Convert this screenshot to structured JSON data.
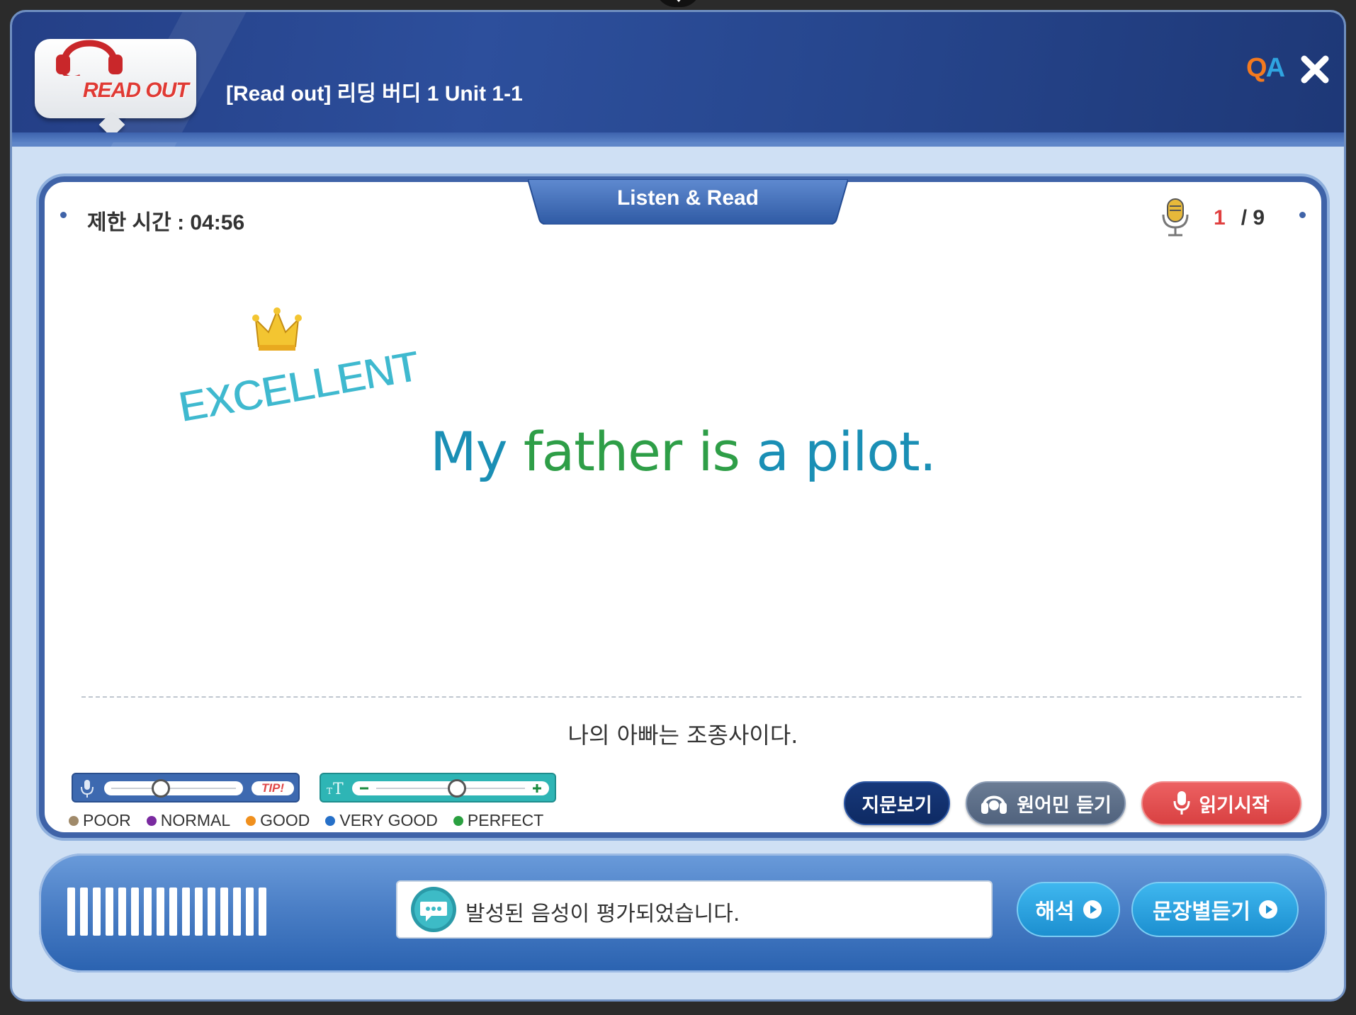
{
  "header": {
    "logo_text": "READ OUT",
    "title": "[Read out] 리딩 버디 1 Unit 1-1",
    "qa_q": "Q",
    "qa_a": "A"
  },
  "panel": {
    "timer": "제한 시간 : 04:56",
    "tab_title": "Listen & Read",
    "counter_current": "1",
    "counter_total": "/ 9",
    "result_badge": "EXCELLENT",
    "sentence_words": [
      {
        "text": "My",
        "color": "#1a8fb5"
      },
      {
        "text": "father",
        "color": "#2e9e47"
      },
      {
        "text": "is",
        "color": "#2e9e47"
      },
      {
        "text": "a",
        "color": "#1a8fb5"
      },
      {
        "text": "pilot.",
        "color": "#1a8fb5"
      }
    ],
    "translation": "나의 아빠는 조종사이다.",
    "tip_label": "TIP!",
    "mic_sensitivity_level": 0.38,
    "font_size_level": 0.55
  },
  "legend": [
    {
      "label": "POOR",
      "color": "#a08a6a"
    },
    {
      "label": "NORMAL",
      "color": "#7a2aa0"
    },
    {
      "label": "GOOD",
      "color": "#f0901e"
    },
    {
      "label": "VERY GOOD",
      "color": "#2670c8"
    },
    {
      "label": "PERFECT",
      "color": "#2aa040"
    }
  ],
  "buttons": {
    "passage": "지문보기",
    "native": "원어민 듣기",
    "read": "읽기시작",
    "interpretation": "해석",
    "sentence_listen": "문장별듣기"
  },
  "status": {
    "message": "발성된 음성이 평가되었습니다."
  },
  "colors": {
    "header_blue": "#27478f",
    "read_red": "#e04848",
    "accent_teal": "#2eb5b5"
  }
}
